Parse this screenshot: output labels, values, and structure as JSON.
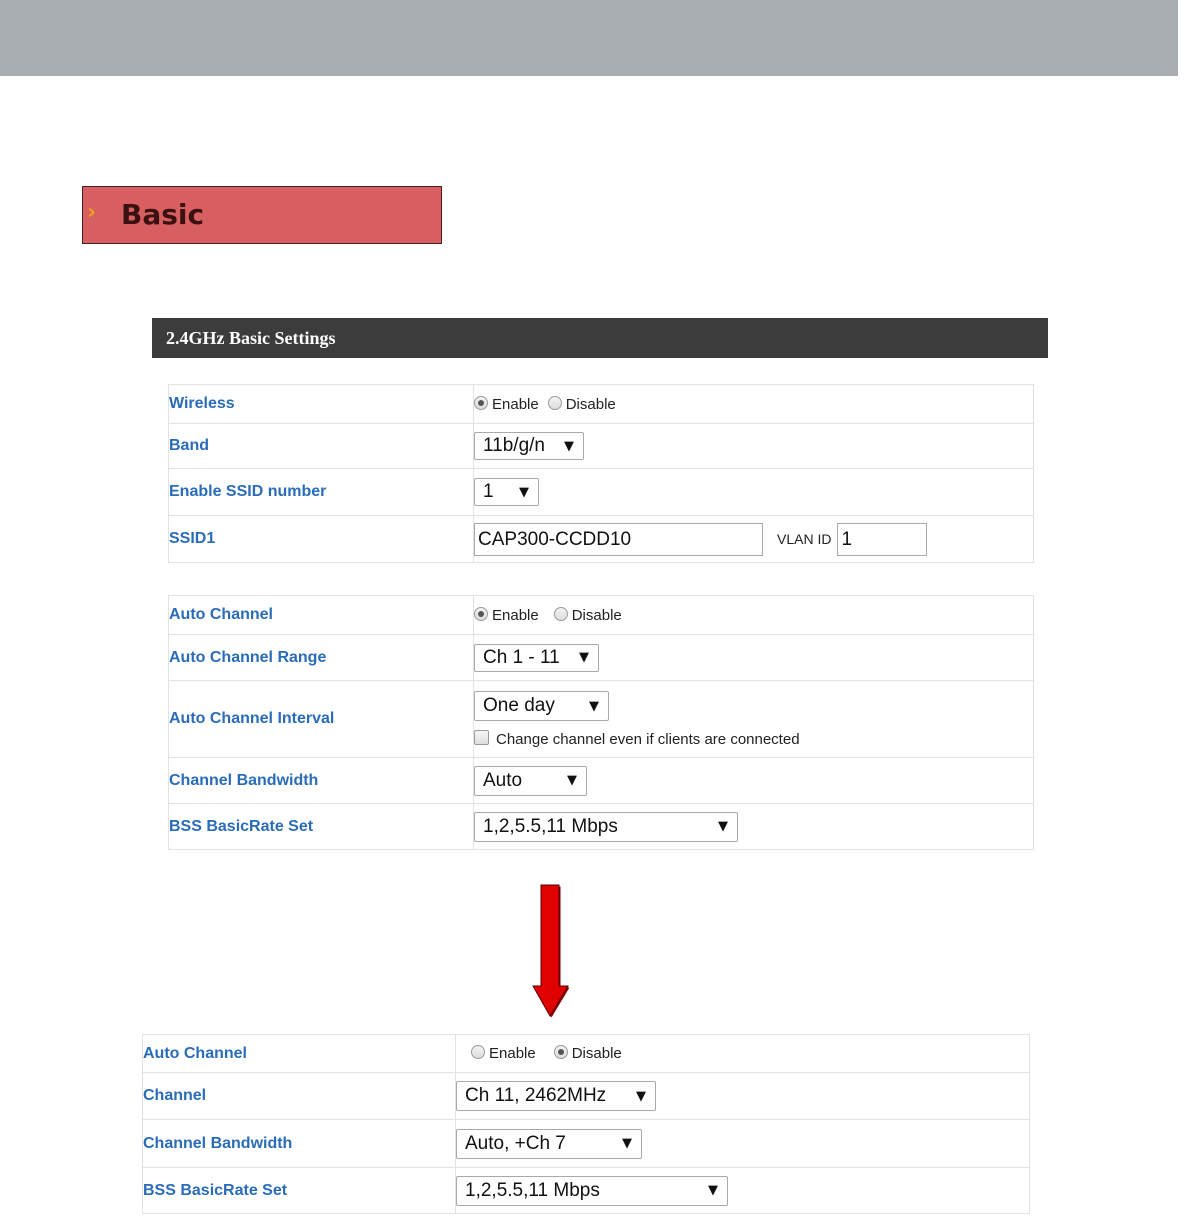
{
  "section_tab": {
    "label": "Basic"
  },
  "header": {
    "title": "2.4GHz Basic Settings"
  },
  "wireless_group": {
    "wireless": {
      "label": "Wireless",
      "enable_label": "Enable",
      "disable_label": "Disable",
      "selected": "Enable"
    },
    "band": {
      "label": "Band",
      "value": "11b/g/n"
    },
    "ssid_number": {
      "label": "Enable SSID number",
      "value": "1"
    },
    "ssid1": {
      "label": "SSID1",
      "value": "CAP300-CCDD10",
      "vlan_label": "VLAN ID",
      "vlan_value": "1"
    }
  },
  "channel_group": {
    "auto_channel": {
      "label": "Auto Channel",
      "enable_label": "Enable",
      "disable_label": "Disable",
      "selected": "Enable"
    },
    "auto_channel_range": {
      "label": "Auto Channel Range",
      "value": "Ch 1 - 11"
    },
    "auto_channel_interval": {
      "label": "Auto Channel Interval",
      "value": "One day",
      "checkbox_label": "Change channel even if clients are connected",
      "checked": false
    },
    "channel_bandwidth": {
      "label": "Channel Bandwidth",
      "value": "Auto"
    },
    "bss_basic_rate_set": {
      "label": "BSS BasicRate Set",
      "value": "1,2,5.5,11 Mbps"
    }
  },
  "disabled_group": {
    "auto_channel": {
      "label": "Auto Channel",
      "enable_label": "Enable",
      "disable_label": "Disable",
      "selected": "Disable"
    },
    "channel": {
      "label": "Channel",
      "value": "Ch 11, 2462MHz"
    },
    "channel_bandwidth": {
      "label": "Channel Bandwidth",
      "value": "Auto, +Ch 7"
    },
    "bss_basic_rate_set": {
      "label": "BSS BasicRate Set",
      "value": "1,2,5.5,11 Mbps"
    }
  },
  "colors": {
    "label_blue": "#2a6cb8",
    "header_bg": "#3c3c3c",
    "tab_bg": "#d75f62",
    "arrow_red": "#e00000"
  },
  "icons": [
    "chevron-right-icon",
    "down-arrow-icon"
  ]
}
